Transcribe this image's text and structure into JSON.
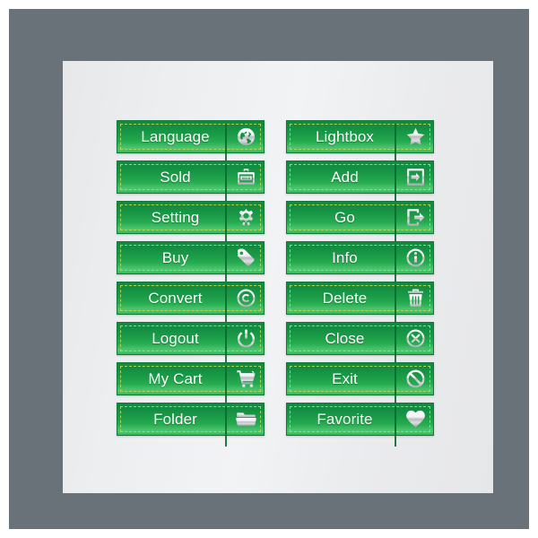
{
  "page": {
    "title": "Green Web Button Icon Set",
    "frame_color": "#697279",
    "panel_color": "#e9eaec",
    "button_green_dark": "#12893f",
    "button_green_light": "#34bc59",
    "stitch_color": "#b7d94f",
    "divider_color": "#0c6b31",
    "label_color": "#ffffff"
  },
  "columns": {
    "left": {
      "buttons": [
        {
          "label": "Language",
          "icon": "globe-icon"
        },
        {
          "label": "Sold",
          "icon": "sold-basket-icon"
        },
        {
          "label": "Setting",
          "icon": "gear-icon"
        },
        {
          "label": "Buy",
          "icon": "price-tag-icon"
        },
        {
          "label": "Convert",
          "icon": "copyright-icon"
        },
        {
          "label": "Logout",
          "icon": "power-icon"
        },
        {
          "label": "My Cart",
          "icon": "shopping-cart-icon"
        },
        {
          "label": "Folder",
          "icon": "folder-icon"
        }
      ]
    },
    "right": {
      "buttons": [
        {
          "label": "Lightbox",
          "icon": "star-icon"
        },
        {
          "label": "Add",
          "icon": "add-box-icon"
        },
        {
          "label": "Go",
          "icon": "enter-arrow-icon"
        },
        {
          "label": "Info",
          "icon": "info-circle-icon"
        },
        {
          "label": "Delete",
          "icon": "trash-icon"
        },
        {
          "label": "Close",
          "icon": "close-circle-icon"
        },
        {
          "label": "Exit",
          "icon": "no-entry-icon"
        },
        {
          "label": "Favorite",
          "icon": "heart-icon"
        }
      ]
    }
  }
}
